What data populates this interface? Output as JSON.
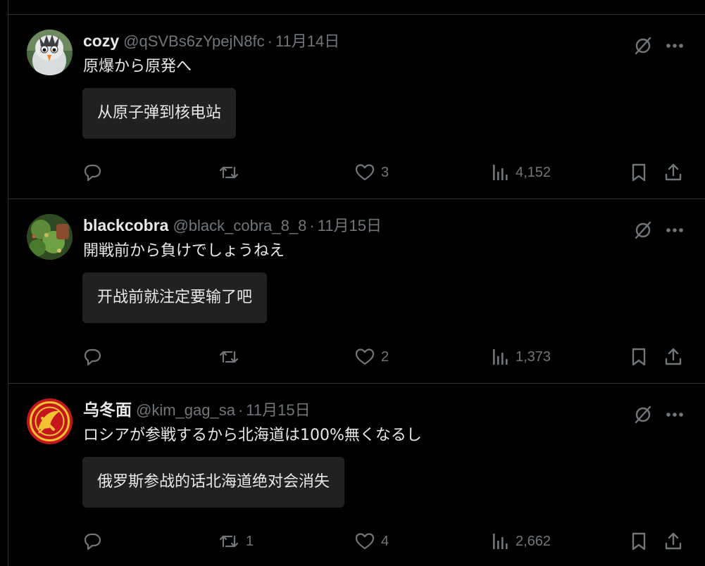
{
  "colors": {
    "background": "#000000",
    "text_primary": "#e7e9ea",
    "text_secondary": "#71767b",
    "divider": "#2f3336",
    "translation_box": "#222121"
  },
  "icons": {
    "reply": "speech-bubble-icon",
    "repost": "repost-arrows-icon",
    "like": "heart-icon",
    "views": "bar-chart-icon",
    "bookmark": "bookmark-icon",
    "share": "share-upload-icon",
    "grok": "grok-slash-icon",
    "more": "more-dots-icon"
  },
  "posts": [
    {
      "name": "cozy",
      "handle": "@qSVBs6zYpejN8fc",
      "separator": "·",
      "date": "11月14日",
      "text": "原爆から原発へ",
      "translation": "从原子弹到核电站",
      "replies": "",
      "reposts": "",
      "likes": "3",
      "views": "4,152"
    },
    {
      "name": "blackcobra",
      "handle": "@black_cobra_8_8",
      "separator": "·",
      "date": "11月15日",
      "text": "開戦前から負けでしょうねえ",
      "translation": "开战前就注定要输了吧",
      "replies": "",
      "reposts": "",
      "likes": "2",
      "views": "1,373"
    },
    {
      "name": "乌冬面",
      "handle": "@kim_gag_sa",
      "separator": "·",
      "date": "11月15日",
      "text": "ロシアが参戦するから北海道は100%無くなるし",
      "translation": "俄罗斯参战的话北海道绝对会消失",
      "replies": "",
      "reposts": "1",
      "likes": "4",
      "views": "2,662"
    }
  ]
}
